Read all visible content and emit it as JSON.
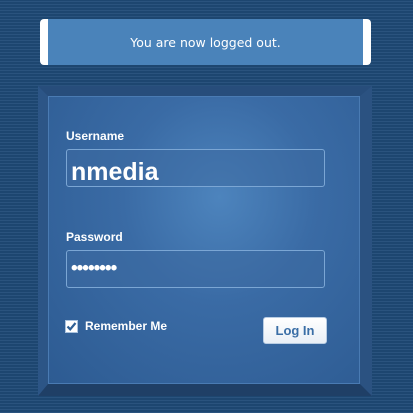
{
  "notice": {
    "message": "You are now logged out."
  },
  "login_form": {
    "username_label": "Username",
    "username_value": "nmedia",
    "password_label": "Password",
    "password_value": "••••••••",
    "remember_me_label": "Remember Me",
    "remember_me_checked": true,
    "submit_label": "Log In"
  },
  "colors": {
    "background": "#1f4a77",
    "panel": "#3a6ba5",
    "message_bar": "#4a83ba",
    "button_text": "#3a6ea6"
  }
}
